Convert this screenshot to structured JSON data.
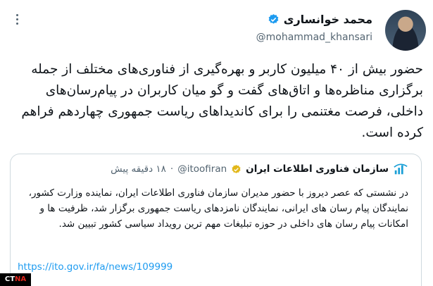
{
  "author": {
    "name": "محمد خوانساری",
    "handle": "@mohammad_khansari",
    "verified_color": "#1d9bf0"
  },
  "tweet": {
    "text": "حضور بیش از ۴۰ میلیون کاربر و بهره‌گیری از فناوری‌های مختلف از جمله برگزاری مناظره‌ها و اتاق‌های گفت و گو میان کاربران در پیام‌رسان‌های داخلی، فرصت مغتنمی را برای کاندیداهای ریاست جمهوری چهاردهم فراهم کرده است."
  },
  "quote": {
    "name": "سازمان فناوری اطلاعات ایران",
    "handle": "@itoofiran",
    "separator": "·",
    "time": "۱۸ دقیقه پیش",
    "badge_color": "#e2b719",
    "text": "در نشستی که عصر دیروز با حضور مدیران سازمان فناوری اطلاعات ایران، نماینده وزارت کشور، نمایندگان پیام رسان های ایرانی، نمایندگان نامزدهای ریاست جمهوری برگزار شد، ظرفیت ها و امکانات پیام رسان های داخلی در حوزه تبلیغات مهم ترین رویداد سیاسی کشور تبیین شد.",
    "link": "https://ito.gov.ir/fa/news/109999"
  },
  "icons": {
    "more": "more-horizontal-icon",
    "verified": "verified-badge-icon",
    "org_logo": "ito-logo-icon",
    "gold": "gold-check-badge-icon"
  },
  "watermark": {
    "prefix": "CT",
    "suffix": "NA"
  }
}
